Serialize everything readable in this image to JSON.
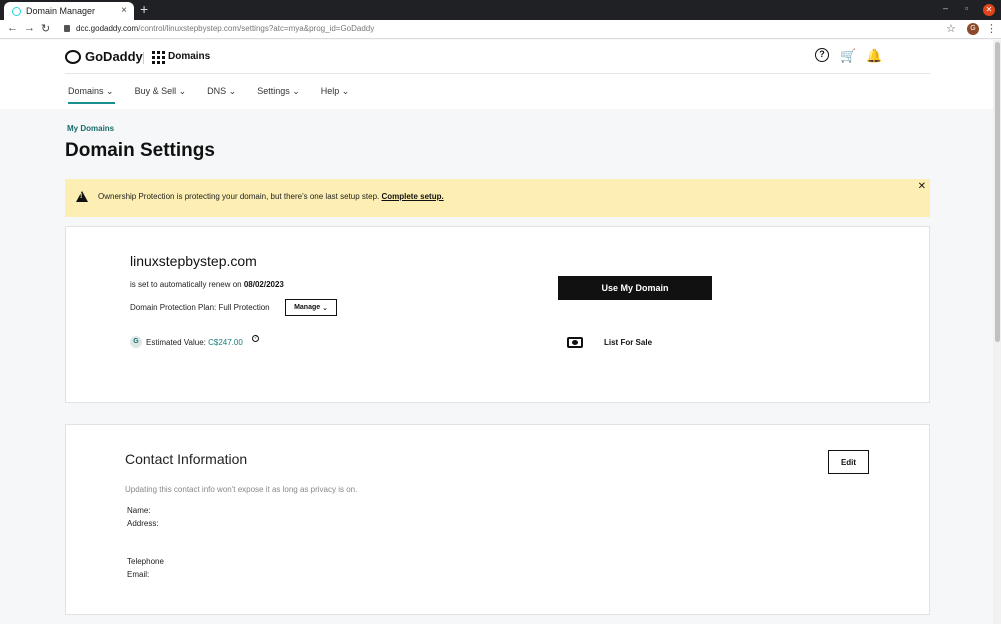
{
  "browser": {
    "tab_title": "Domain Manager",
    "tab_close": "×",
    "new_tab": "+",
    "url_host": "dcc.godaddy.com",
    "url_path": "/control/linuxstepbystep.com/settings?atc=mya&prog_id=GoDaddy",
    "profile_initial": "G"
  },
  "header": {
    "logo_text": "GoDaddy",
    "product": "Domains",
    "help_label": "?",
    "nav": [
      {
        "label": "Domains"
      },
      {
        "label": "Buy & Sell"
      },
      {
        "label": "DNS"
      },
      {
        "label": "Settings"
      },
      {
        "label": "Help"
      }
    ]
  },
  "breadcrumb": "My Domains",
  "title": "Domain Settings",
  "alert": {
    "message": "Ownership Protection is protecting your domain, but there's one last setup step.",
    "link": "Complete setup."
  },
  "domain_card": {
    "domain": "linuxstepbystep.com",
    "renew_text": "is set to automatically renew on",
    "renew_date": "08/02/2023",
    "plan_text": "Domain Protection Plan: Full Protection",
    "manage_label": "Manage",
    "badge": "G",
    "estimated_label": "Estimated Value:",
    "estimated_value": "C$247.00",
    "use_domain_label": "Use My Domain",
    "list_for_sale_label": "List For Sale"
  },
  "contact_card": {
    "title": "Contact Information",
    "subtitle": "Updating this contact info won't expose it as long as privacy is on.",
    "edit_label": "Edit",
    "labels": {
      "name": "Name:",
      "address": "Address:",
      "telephone": "Telephone",
      "email": "Email:"
    }
  },
  "colors": {
    "accent": "#1b8f8f",
    "alert_bg": "#fdefb3",
    "button_dark": "#111111"
  }
}
